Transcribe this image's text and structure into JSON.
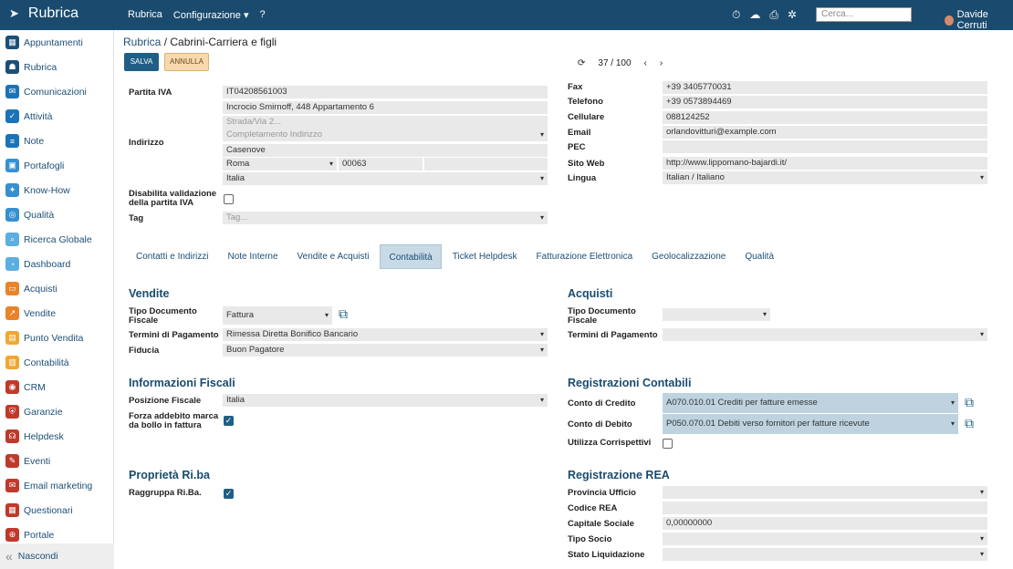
{
  "app": {
    "name": "Rubrica"
  },
  "topnav": [
    "Rubrica",
    "Configurazione ▾",
    "?"
  ],
  "search": {
    "placeholder": "Cerca..."
  },
  "user": {
    "name": "Davide Cerruti"
  },
  "sidebar": {
    "items": [
      {
        "label": "Appuntamenti",
        "color": "#1c4f77",
        "glyph": "▦"
      },
      {
        "label": "Rubrica",
        "color": "#1c4f77",
        "glyph": "☗"
      },
      {
        "label": "Comunicazioni",
        "color": "#1a74b8",
        "glyph": "✉"
      },
      {
        "label": "Attività",
        "color": "#1a74b8",
        "glyph": "✓"
      },
      {
        "label": "Note",
        "color": "#1a74b8",
        "glyph": "≡"
      },
      {
        "label": "Portafogli",
        "color": "#3590d1",
        "glyph": "▣"
      },
      {
        "label": "Know-How",
        "color": "#3590d1",
        "glyph": "✦"
      },
      {
        "label": "Qualità",
        "color": "#3590d1",
        "glyph": "◎"
      },
      {
        "label": "Ricerca Globale",
        "color": "#5aaee0",
        "glyph": "⌕"
      },
      {
        "label": "Dashboard",
        "color": "#5aaee0",
        "glyph": "◔"
      },
      {
        "label": "Acquisti",
        "color": "#e8832a",
        "glyph": "▭"
      },
      {
        "label": "Vendite",
        "color": "#e8832a",
        "glyph": "↗"
      },
      {
        "label": "Punto Vendita",
        "color": "#f0a732",
        "glyph": "▤"
      },
      {
        "label": "Contabilità",
        "color": "#f0a732",
        "glyph": "▥"
      },
      {
        "label": "CRM",
        "color": "#c0392b",
        "glyph": "◉"
      },
      {
        "label": "Garanzie",
        "color": "#c0392b",
        "glyph": "⛨"
      },
      {
        "label": "Helpdesk",
        "color": "#c0392b",
        "glyph": "☊"
      },
      {
        "label": "Eventi",
        "color": "#c0392b",
        "glyph": "✎"
      },
      {
        "label": "Email marketing",
        "color": "#c0392b",
        "glyph": "✉"
      },
      {
        "label": "Questionari",
        "color": "#c0392b",
        "glyph": "▦"
      },
      {
        "label": "Portale",
        "color": "#c0392b",
        "glyph": "⊕"
      }
    ],
    "hide": "Nascondi"
  },
  "breadcrumb": {
    "root": "Rubrica",
    "current": "Cabrini-Carriera e figli"
  },
  "toolbar": {
    "save": "SALVA",
    "cancel": "ANNULLA"
  },
  "pager": {
    "position": "37 / 100"
  },
  "anagrafica": {
    "piva_label": "Partita IVA",
    "piva": "IT04208561003",
    "indirizzo_label": "Indirizzo",
    "via": "Incrocio Smirnoff, 448 Appartamento 6",
    "strada_placeholder": "Strada/Via 2...",
    "completamento_placeholder": "Completamento Indirizzo",
    "citta": "Casenove",
    "provincia": "Roma",
    "cap": "00063",
    "paese": "Italia",
    "disabilita_label": "Disabilita validazione della partita IVA",
    "tag_label": "Tag",
    "tag_placeholder": "Tag...",
    "fax_label": "Fax",
    "fax": "+39 3405770031",
    "telefono_label": "Telefono",
    "telefono": "+39 0573894469",
    "cellulare_label": "Cellulare",
    "cellulare": "088124252",
    "email_label": "Email",
    "email": "orlandovitturi@example.com",
    "pec_label": "PEC",
    "pec": "",
    "sito_label": "Sito Web",
    "sito": "http://www.lippomano-bajardi.it/",
    "lingua_label": "Lingua",
    "lingua": "Italian / Italiano"
  },
  "tabs": [
    "Contatti e Indirizzi",
    "Note Interne",
    "Vendite e Acquisti",
    "Contabilità",
    "Ticket Helpdesk",
    "Fatturazione Elettronica",
    "Geolocalizzazione",
    "Qualità"
  ],
  "vendite": {
    "title": "Vendite",
    "tipo_label": "Tipo Documento Fiscale",
    "tipo": "Fattura",
    "termini_label": "Termini di Pagamento",
    "termini": "Rimessa Diretta Bonifico Bancario",
    "fiducia_label": "Fiducia",
    "fiducia": "Buon Pagatore"
  },
  "acquisti": {
    "title": "Acquisti",
    "tipo_label": "Tipo Documento Fiscale",
    "tipo": "",
    "termini_label": "Termini di Pagamento",
    "termini": ""
  },
  "fiscali": {
    "title": "Informazioni Fiscali",
    "posizione_label": "Posizione Fiscale",
    "posizione": "Italia",
    "forza_label": "Forza addebito marca da bollo in fattura"
  },
  "registrazioni": {
    "title": "Registrazioni Contabili",
    "credito_label": "Conto di Credito",
    "credito": "A070.010.01 Crediti per fatture emesse",
    "debito_label": "Conto di Debito",
    "debito": "P050.070.01 Debiti verso fornitori per fatture ricevute",
    "corrispettivi_label": "Utilizza Corrispettivi"
  },
  "riba": {
    "title": "Proprietà Ri.ba",
    "raggruppa_label": "Raggruppa Ri.Ba."
  },
  "rea": {
    "title": "Registrazione REA",
    "provincia_label": "Provincia Ufficio",
    "codice_label": "Codice REA",
    "capitale_label": "Capitale Sociale",
    "capitale": "0,00000000",
    "socio_label": "Tipo Socio",
    "liquidazione_label": "Stato Liquidazione"
  }
}
